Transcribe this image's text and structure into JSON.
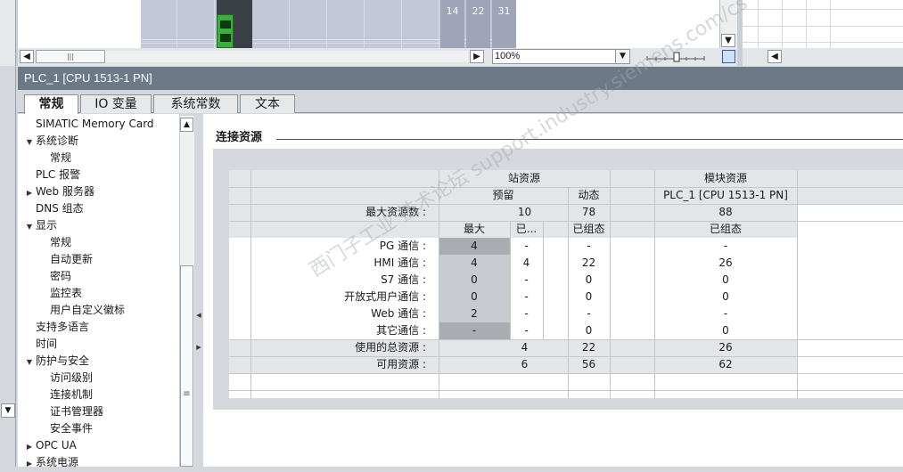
{
  "top_view": {
    "slot_numbers": [
      "14",
      "22",
      "31"
    ],
    "zoom_level": "100%"
  },
  "inspector": {
    "title": "PLC_1 [CPU 1513-1 PN]",
    "tabs": [
      {
        "label": "常规",
        "active": true
      },
      {
        "label": "IO 变量",
        "active": false
      },
      {
        "label": "系统常数",
        "active": false
      },
      {
        "label": "文本",
        "active": false
      }
    ]
  },
  "nav": {
    "items": [
      {
        "label": "SIMATIC Memory Card",
        "level": 0,
        "arrow": ""
      },
      {
        "label": "系统诊断",
        "level": 0,
        "arrow": "down"
      },
      {
        "label": "常规",
        "level": 1,
        "arrow": ""
      },
      {
        "label": "PLC 报警",
        "level": 0,
        "arrow": ""
      },
      {
        "label": "Web 服务器",
        "level": 0,
        "arrow": "right"
      },
      {
        "label": "DNS 组态",
        "level": 0,
        "arrow": ""
      },
      {
        "label": "显示",
        "level": 0,
        "arrow": "down"
      },
      {
        "label": "常规",
        "level": 1,
        "arrow": ""
      },
      {
        "label": "自动更新",
        "level": 1,
        "arrow": ""
      },
      {
        "label": "密码",
        "level": 1,
        "arrow": ""
      },
      {
        "label": "监控表",
        "level": 1,
        "arrow": ""
      },
      {
        "label": "用户自定义徽标",
        "level": 1,
        "arrow": ""
      },
      {
        "label": "支持多语言",
        "level": 0,
        "arrow": ""
      },
      {
        "label": "时间",
        "level": 0,
        "arrow": ""
      },
      {
        "label": "防护与安全",
        "level": 0,
        "arrow": "down"
      },
      {
        "label": "访问级别",
        "level": 1,
        "arrow": ""
      },
      {
        "label": "连接机制",
        "level": 1,
        "arrow": ""
      },
      {
        "label": "证书管理器",
        "level": 1,
        "arrow": ""
      },
      {
        "label": "安全事件",
        "level": 1,
        "arrow": ""
      },
      {
        "label": "OPC UA",
        "level": 0,
        "arrow": "right"
      },
      {
        "label": "系统电源",
        "level": 0,
        "arrow": "right"
      }
    ]
  },
  "section": {
    "title": "连接资源"
  },
  "resources": {
    "header_station": "站资源",
    "header_module": "模块资源",
    "sub_reserved": "预留",
    "sub_dynamic": "动态",
    "sub_module_name": "PLC_1 [CPU 1513-1 PN]",
    "max_label": "最大资源数 :",
    "max_reserved": "10",
    "max_dynamic": "78",
    "max_module": "88",
    "col_max": "最大",
    "col_used": "已...",
    "col_configured": "已组态",
    "col_module_configured": "已组态",
    "rows": [
      {
        "label": "PG 通信 :",
        "max": "4",
        "used": "-",
        "dynamic": "-",
        "module": "-"
      },
      {
        "label": "HMI 通信 :",
        "max": "4",
        "used": "4",
        "dynamic": "22",
        "module": "26"
      },
      {
        "label": "S7 通信 :",
        "max": "0",
        "used": "-",
        "dynamic": "0",
        "module": "0"
      },
      {
        "label": "开放式用户通信 :",
        "max": "0",
        "used": "-",
        "dynamic": "0",
        "module": "0"
      },
      {
        "label": "Web 通信 :",
        "max": "2",
        "used": "-",
        "dynamic": "-",
        "module": "-"
      },
      {
        "label": "其它通信 :",
        "max": "-",
        "used": "-",
        "dynamic": "0",
        "module": "0"
      }
    ],
    "total_label": "使用的总资源 :",
    "total_used": "4",
    "total_dynamic": "22",
    "total_module": "26",
    "avail_label": "可用资源 :",
    "avail_used": "6",
    "avail_dynamic": "56",
    "avail_module": "62"
  },
  "watermark": "西门子工业 技术论坛 support.industry.siemens.com/cs"
}
